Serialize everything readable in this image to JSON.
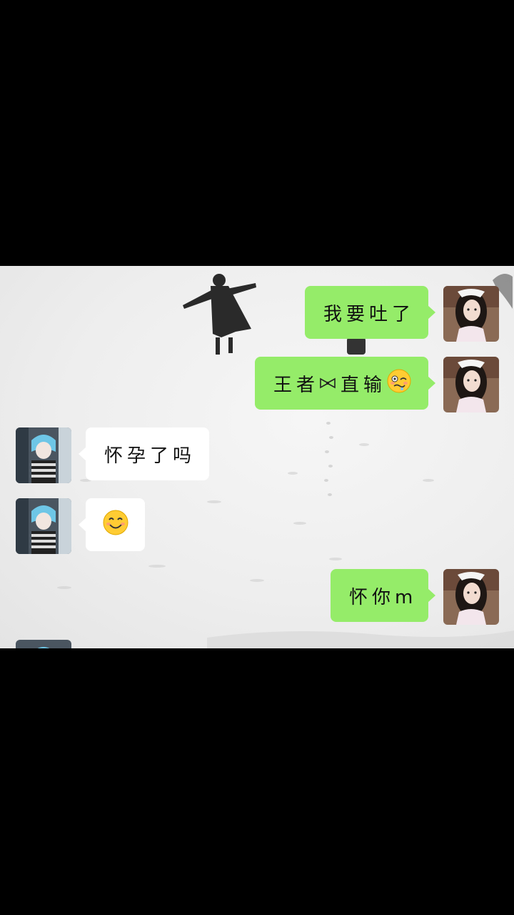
{
  "conversation": {
    "messages": [
      {
        "side": "right",
        "kind": "text",
        "text": "我要吐了"
      },
      {
        "side": "right",
        "kind": "text",
        "text_before": "王者",
        "emoji_1": "bow-emoji",
        "text_mid": "直输",
        "emoji_2": "woozy-face-emoji"
      },
      {
        "side": "left",
        "kind": "text",
        "text": "怀孕了吗"
      },
      {
        "side": "left",
        "kind": "emoji",
        "emoji": "smiling-face-emoji"
      },
      {
        "side": "right",
        "kind": "text",
        "text": "怀你m"
      }
    ]
  },
  "colors": {
    "outgoing_bubble": "#95ec69",
    "incoming_bubble": "#ffffff",
    "background": "#eeeeee",
    "letterbox": "#000000"
  },
  "avatars": {
    "self": "girl-avatar",
    "other": "anime-boy-avatar"
  }
}
